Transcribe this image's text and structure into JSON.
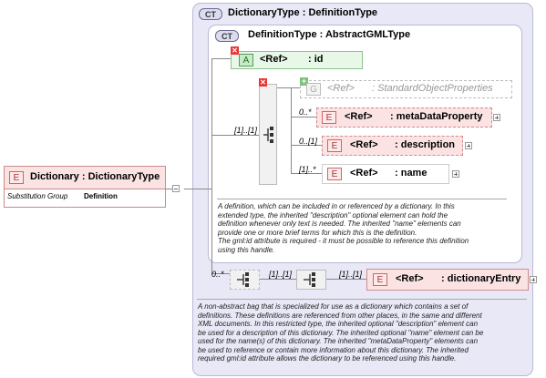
{
  "root": {
    "badge": "E",
    "name": "Dictionary",
    "sep": ":",
    "type": "DictionaryType",
    "subst_label": "Substitution Group",
    "subst_value": "Definition"
  },
  "outer": {
    "badge": "CT",
    "name": "DictionaryType",
    "sep": ":",
    "type": "DefinitionType",
    "description": [
      "A non-abstract bag that is specialized for use as a dictionary which contains a set of",
      "definitions. These definitions are referenced from other places, in the same and different",
      "XML documents. In this restricted type, the inherited optional \"description\" element can",
      "be used for a description of this dictionary. The inherited optional \"name\" element can be",
      "used for the name(s) of this dictionary. The inherited \"metaDataProperty\" elements can",
      "be used to reference or contain more information about this dictionary. The inherited",
      "required gml:id attribute allows the dictionary to be referenced using this handle."
    ]
  },
  "inner": {
    "badge": "CT",
    "name": "DefinitionType",
    "sep": ":",
    "type": "AbstractGMLType",
    "description": [
      "A definition, which can be included in or referenced by a dictionary. In this",
      "extended type, the inherited \"description\" optional element can hold the",
      "definition whenever only text is needed. The inherited \"name\" elements can",
      "provide one or more brief terms for which this is the definition.",
      "The gml:id attribute is required - it must be possible to reference this definition",
      "using this handle."
    ]
  },
  "attr": {
    "badge": "A",
    "ref": "<Ref>",
    "name": ": id"
  },
  "group": {
    "badge": "G",
    "ref": "<Ref>",
    "name": ": StandardObjectProperties"
  },
  "seq_card": "[1]..[1]",
  "children": [
    {
      "card": "0..*",
      "badge": "E",
      "ref": "<Ref>",
      "name": ": metaDataProperty"
    },
    {
      "card": "0..[1]",
      "badge": "E",
      "ref": "<Ref>",
      "name": ": description"
    },
    {
      "card": "[1]..*",
      "badge": "E",
      "ref": "<Ref>",
      "name": ": name"
    }
  ],
  "entry": {
    "outer_card": "0..*",
    "seq_card": "[1]..[1]",
    "el_card": "[1]..[1]",
    "badge": "E",
    "ref": "<Ref>",
    "name": ": dictionaryEntry"
  }
}
